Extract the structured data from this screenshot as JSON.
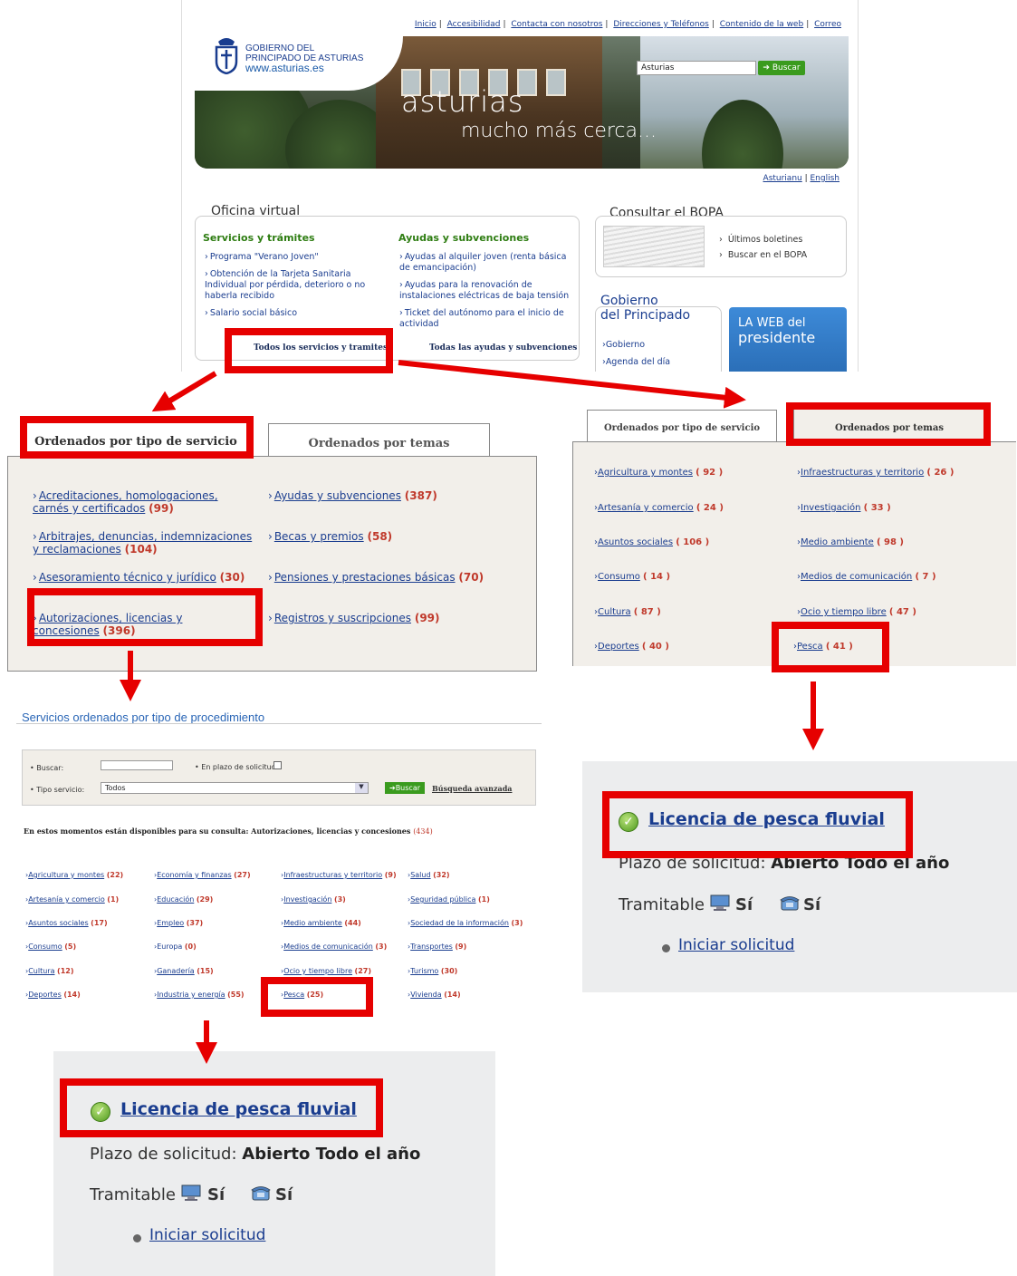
{
  "portal": {
    "top_links": [
      "Inicio",
      "Accesibilidad",
      "Contacta con nosotros",
      "Direcciones y Teléfonos",
      "Contenido de la web",
      "Correo"
    ],
    "logo_line1": "GOBIERNO DEL",
    "logo_line2": "PRINCIPADO DE ASTURIAS",
    "logo_url": "www.asturias.es",
    "search_value": "Asturias",
    "search_button": "Buscar",
    "banner_title": "asturias",
    "banner_subtitle": "mucho más cerca...",
    "lang_asturianu": "Asturianu",
    "lang_english": "English",
    "oficina_title": "Oficina virtual",
    "servicios_heading": "Servicios y trámites",
    "servicios_items": [
      "Programa \"Verano Joven\"",
      "Obtención de la Tarjeta Sanitaria Individual por pérdida, deterioro o no haberla recibido",
      "Salario social básico"
    ],
    "ayudas_heading": "Ayudas y subvenciones",
    "ayudas_items": [
      "Ayudas al alquiler joven (renta básica de emancipación)",
      "Ayudas para la renovación de instalaciones eléctricas de baja tensión",
      "Ticket del autónomo para el inicio de actividad"
    ],
    "todos_servicios": "Todos los servicios y tramites",
    "todas_ayudas": "Todas las ayudas y subvenciones",
    "bopa_title": "Consultar el BOPA",
    "bopa_links": [
      "Últimos boletines",
      "Buscar en el BOPA"
    ],
    "gobierno_title_1": "Gobierno",
    "gobierno_title_2": "del Principado",
    "gobierno_links": [
      "Gobierno",
      "Agenda del día"
    ],
    "presidente_1": "LA WEB del",
    "presidente_2": "presidente"
  },
  "tabs_tipo": {
    "tab_tipo": "Ordenados por tipo de servicio",
    "tab_temas": "Ordenados por temas",
    "left": [
      {
        "label": "Acreditaciones, homologaciones, carnés y certificados",
        "count": "(99)"
      },
      {
        "label": "Arbitrajes, denuncias, indemnizaciones y reclamaciones",
        "count": "(104)"
      },
      {
        "label": "Asesoramiento técnico y jurídico",
        "count": "(30)"
      },
      {
        "label": "Autorizaciones, licencias y concesiones",
        "count": "(396)"
      }
    ],
    "right": [
      {
        "label": "Ayudas y subvenciones",
        "count": "(387)"
      },
      {
        "label": "Becas y premios",
        "count": "(58)"
      },
      {
        "label": "Pensiones y prestaciones básicas",
        "count": "(70)"
      },
      {
        "label": "Registros y suscripciones",
        "count": "(99)"
      }
    ]
  },
  "tabs_temas": {
    "tab_tipo": "Ordenados por tipo de servicio",
    "tab_temas": "Ordenados por temas",
    "left": [
      {
        "label": "Agricultura y montes",
        "count": "( 92 )"
      },
      {
        "label": "Artesanía y comercio",
        "count": "( 24 )"
      },
      {
        "label": "Asuntos sociales",
        "count": "( 106 )"
      },
      {
        "label": "Consumo",
        "count": "( 14 )"
      },
      {
        "label": "Cultura",
        "count": "( 87 )"
      },
      {
        "label": "Deportes",
        "count": "( 40 )"
      }
    ],
    "right": [
      {
        "label": "Infraestructuras y territorio",
        "count": "( 26 )"
      },
      {
        "label": "Investigación",
        "count": "( 33 )"
      },
      {
        "label": "Medio ambiente",
        "count": "( 98 )"
      },
      {
        "label": "Medios de comunicación",
        "count": "( 7 )"
      },
      {
        "label": "Ocio y tiempo libre",
        "count": "( 47 )"
      },
      {
        "label": "Pesca",
        "count": "( 41 )"
      }
    ]
  },
  "procedimiento": {
    "title": "Servicios ordenados por tipo de procedimiento",
    "buscar_label": "Buscar:",
    "plazo_label": "En plazo de solicitud",
    "tipo_label": "Tipo servicio:",
    "tipo_value": "Todos",
    "buscar_button": "Buscar",
    "busqueda_avanzada": "Búsqueda avanzada",
    "message": "En estos momentos están disponibles para su consulta: Autorizaciones, licencias y concesiones",
    "message_count": "(434)",
    "columns": [
      [
        [
          "Agricultura y montes",
          "(22)"
        ],
        [
          "Artesanía y comercio",
          "(1)"
        ],
        [
          "Asuntos sociales",
          "(17)"
        ],
        [
          "Consumo",
          "(5)"
        ],
        [
          "Cultura",
          "(12)"
        ],
        [
          "Deportes",
          "(14)"
        ]
      ],
      [
        [
          "Economía y finanzas",
          "(27)"
        ],
        [
          "Educación",
          "(29)"
        ],
        [
          "Empleo",
          "(37)"
        ],
        [
          "Europa",
          "(0)"
        ],
        [
          "Ganadería",
          "(15)"
        ],
        [
          "Industria y energía",
          "(55)"
        ]
      ],
      [
        [
          "Infraestructuras y territorio",
          "(9)"
        ],
        [
          "Investigación",
          "(3)"
        ],
        [
          "Medio ambiente",
          "(44)"
        ],
        [
          "Medios de comunicación",
          "(3)"
        ],
        [
          "Ocio y tiempo libre",
          "(27)"
        ],
        [
          "Pesca",
          "(25)"
        ]
      ],
      [
        [
          "Salud",
          "(32)"
        ],
        [
          "Seguridad pública",
          "(1)"
        ],
        [
          "Sociedad de la información",
          "(3)"
        ],
        [
          "Transportes",
          "(9)"
        ],
        [
          "Turismo",
          "(30)"
        ],
        [
          "Vivienda",
          "(14)"
        ]
      ]
    ]
  },
  "licencia": {
    "title": "Licencia de pesca fluvial",
    "plazo_label": "Plazo de solicitud:",
    "plazo_value": "Abierto Todo el año",
    "tramitable_label": "Tramitable",
    "si_online": "Sí",
    "si_phone": "Sí",
    "iniciar": "Iniciar solicitud"
  },
  "colors": {
    "highlight": "#e60000",
    "link": "#1a3d8f",
    "count": "#c0392b",
    "green_heading": "#2e7d12",
    "panel_bg": "#f2efea"
  }
}
